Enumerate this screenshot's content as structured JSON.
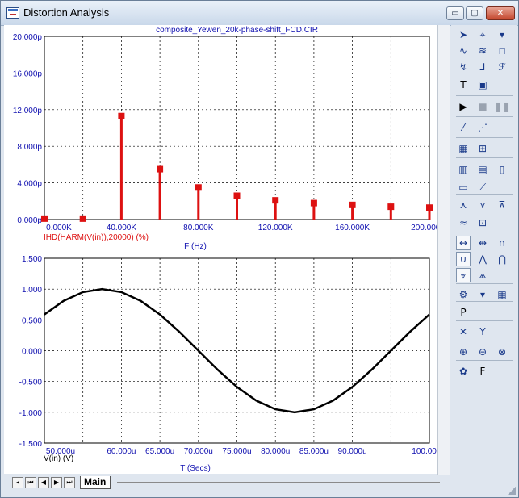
{
  "window": {
    "title": "Distortion Analysis"
  },
  "controls": {
    "minimize": "▭",
    "maximize": "▢",
    "close": "✕"
  },
  "colors": {
    "harmonic": "#dd1111",
    "axis_text": "#1010b0",
    "trace": "#000000"
  },
  "bottom_bar": {
    "tab_main": "Main",
    "nav": [
      "◂",
      "⏮",
      "◀",
      "▶",
      "⏭"
    ]
  },
  "toolbar_icons": [
    "select-arrow-icon",
    "scale-icon",
    "dropdown-arrow-icon",
    "curve-icon",
    "trace-icon",
    "fft-icon",
    "graph-icon",
    "label-icon",
    "fo-icon",
    "text-icon",
    "properties-icon",
    "run-icon",
    "stop-icon",
    "pause-icon",
    "line-icon",
    "dotted-line-icon",
    "grid-icon",
    "fine-grid-icon",
    "bars-icon",
    "hbars-icon",
    "boxes-icon",
    "plot-icon",
    "slope-icon",
    "peak-icon",
    "valley-icon",
    "high-icon",
    "low-icon",
    "point-icon",
    "inflection-icon",
    "global-high-icon",
    "global-low-icon",
    "top-icon",
    "bottom-icon",
    "rise-icon",
    "fall-icon",
    "tracker-icon",
    "cursor-mode-icon",
    "add-curve-icon",
    "table-icon",
    "p-label-icon",
    "x-scale-icon",
    "y-scale-icon",
    "zoom-in-icon",
    "zoom-out-icon",
    "zoom-fit-icon",
    "tool-icon",
    "font-icon"
  ],
  "chart_data": [
    {
      "type": "bar",
      "title": "composite_Yewen_20k-phase-shift_FCD.CIR",
      "xlabel": "F (Hz)",
      "ylabel": "",
      "series": [
        {
          "name": "IHD(HARM(V(in)),20000) (%)",
          "x": [
            0,
            20000,
            40000,
            60000,
            80000,
            100000,
            120000,
            140000,
            160000,
            180000,
            200000
          ],
          "values": [
            0.1,
            0.1,
            11.3,
            5.5,
            3.5,
            2.6,
            2.1,
            1.8,
            1.6,
            1.4,
            1.3
          ]
        }
      ],
      "xlim": [
        0,
        200000
      ],
      "ylim": [
        0,
        20
      ],
      "x_ticks": [
        "0.000K",
        "40.000K",
        "80.000K",
        "120.000K",
        "160.000K",
        "200.000K"
      ],
      "y_ticks": [
        "0.000p",
        "4.000p",
        "8.000p",
        "12.000p",
        "16.000p",
        "20.000p"
      ],
      "grid": true
    },
    {
      "type": "line",
      "title": "",
      "xlabel": "T (Secs)",
      "ylabel": "V(in) (V)",
      "series": [
        {
          "name": "V(in) (V)",
          "x": [
            5e-05,
            5.25e-05,
            5.5e-05,
            5.75e-05,
            6e-05,
            6.25e-05,
            6.5e-05,
            6.75e-05,
            7e-05,
            7.25e-05,
            7.5e-05,
            7.75e-05,
            8e-05,
            8.25e-05,
            8.5e-05,
            8.75e-05,
            9e-05,
            9.25e-05,
            9.5e-05,
            9.75e-05,
            0.0001
          ],
          "values": [
            0.588,
            0.809,
            0.951,
            1.0,
            0.951,
            0.809,
            0.588,
            0.309,
            0.0,
            -0.309,
            -0.588,
            -0.809,
            -0.951,
            -1.0,
            -0.951,
            -0.809,
            -0.588,
            -0.309,
            0.0,
            0.309,
            0.588
          ]
        }
      ],
      "xlim": [
        5e-05,
        0.0001
      ],
      "ylim": [
        -1.5,
        1.5
      ],
      "x_ticks": [
        "50.000u",
        "60.000u",
        "65.000u",
        "70.000u",
        "75.000u",
        "80.000u",
        "85.000u",
        "90.000u",
        "100.000u"
      ],
      "y_ticks": [
        "-1.500",
        "-1.000",
        "-0.500",
        "0.000",
        "0.500",
        "1.000",
        "1.500"
      ],
      "grid": true
    }
  ]
}
